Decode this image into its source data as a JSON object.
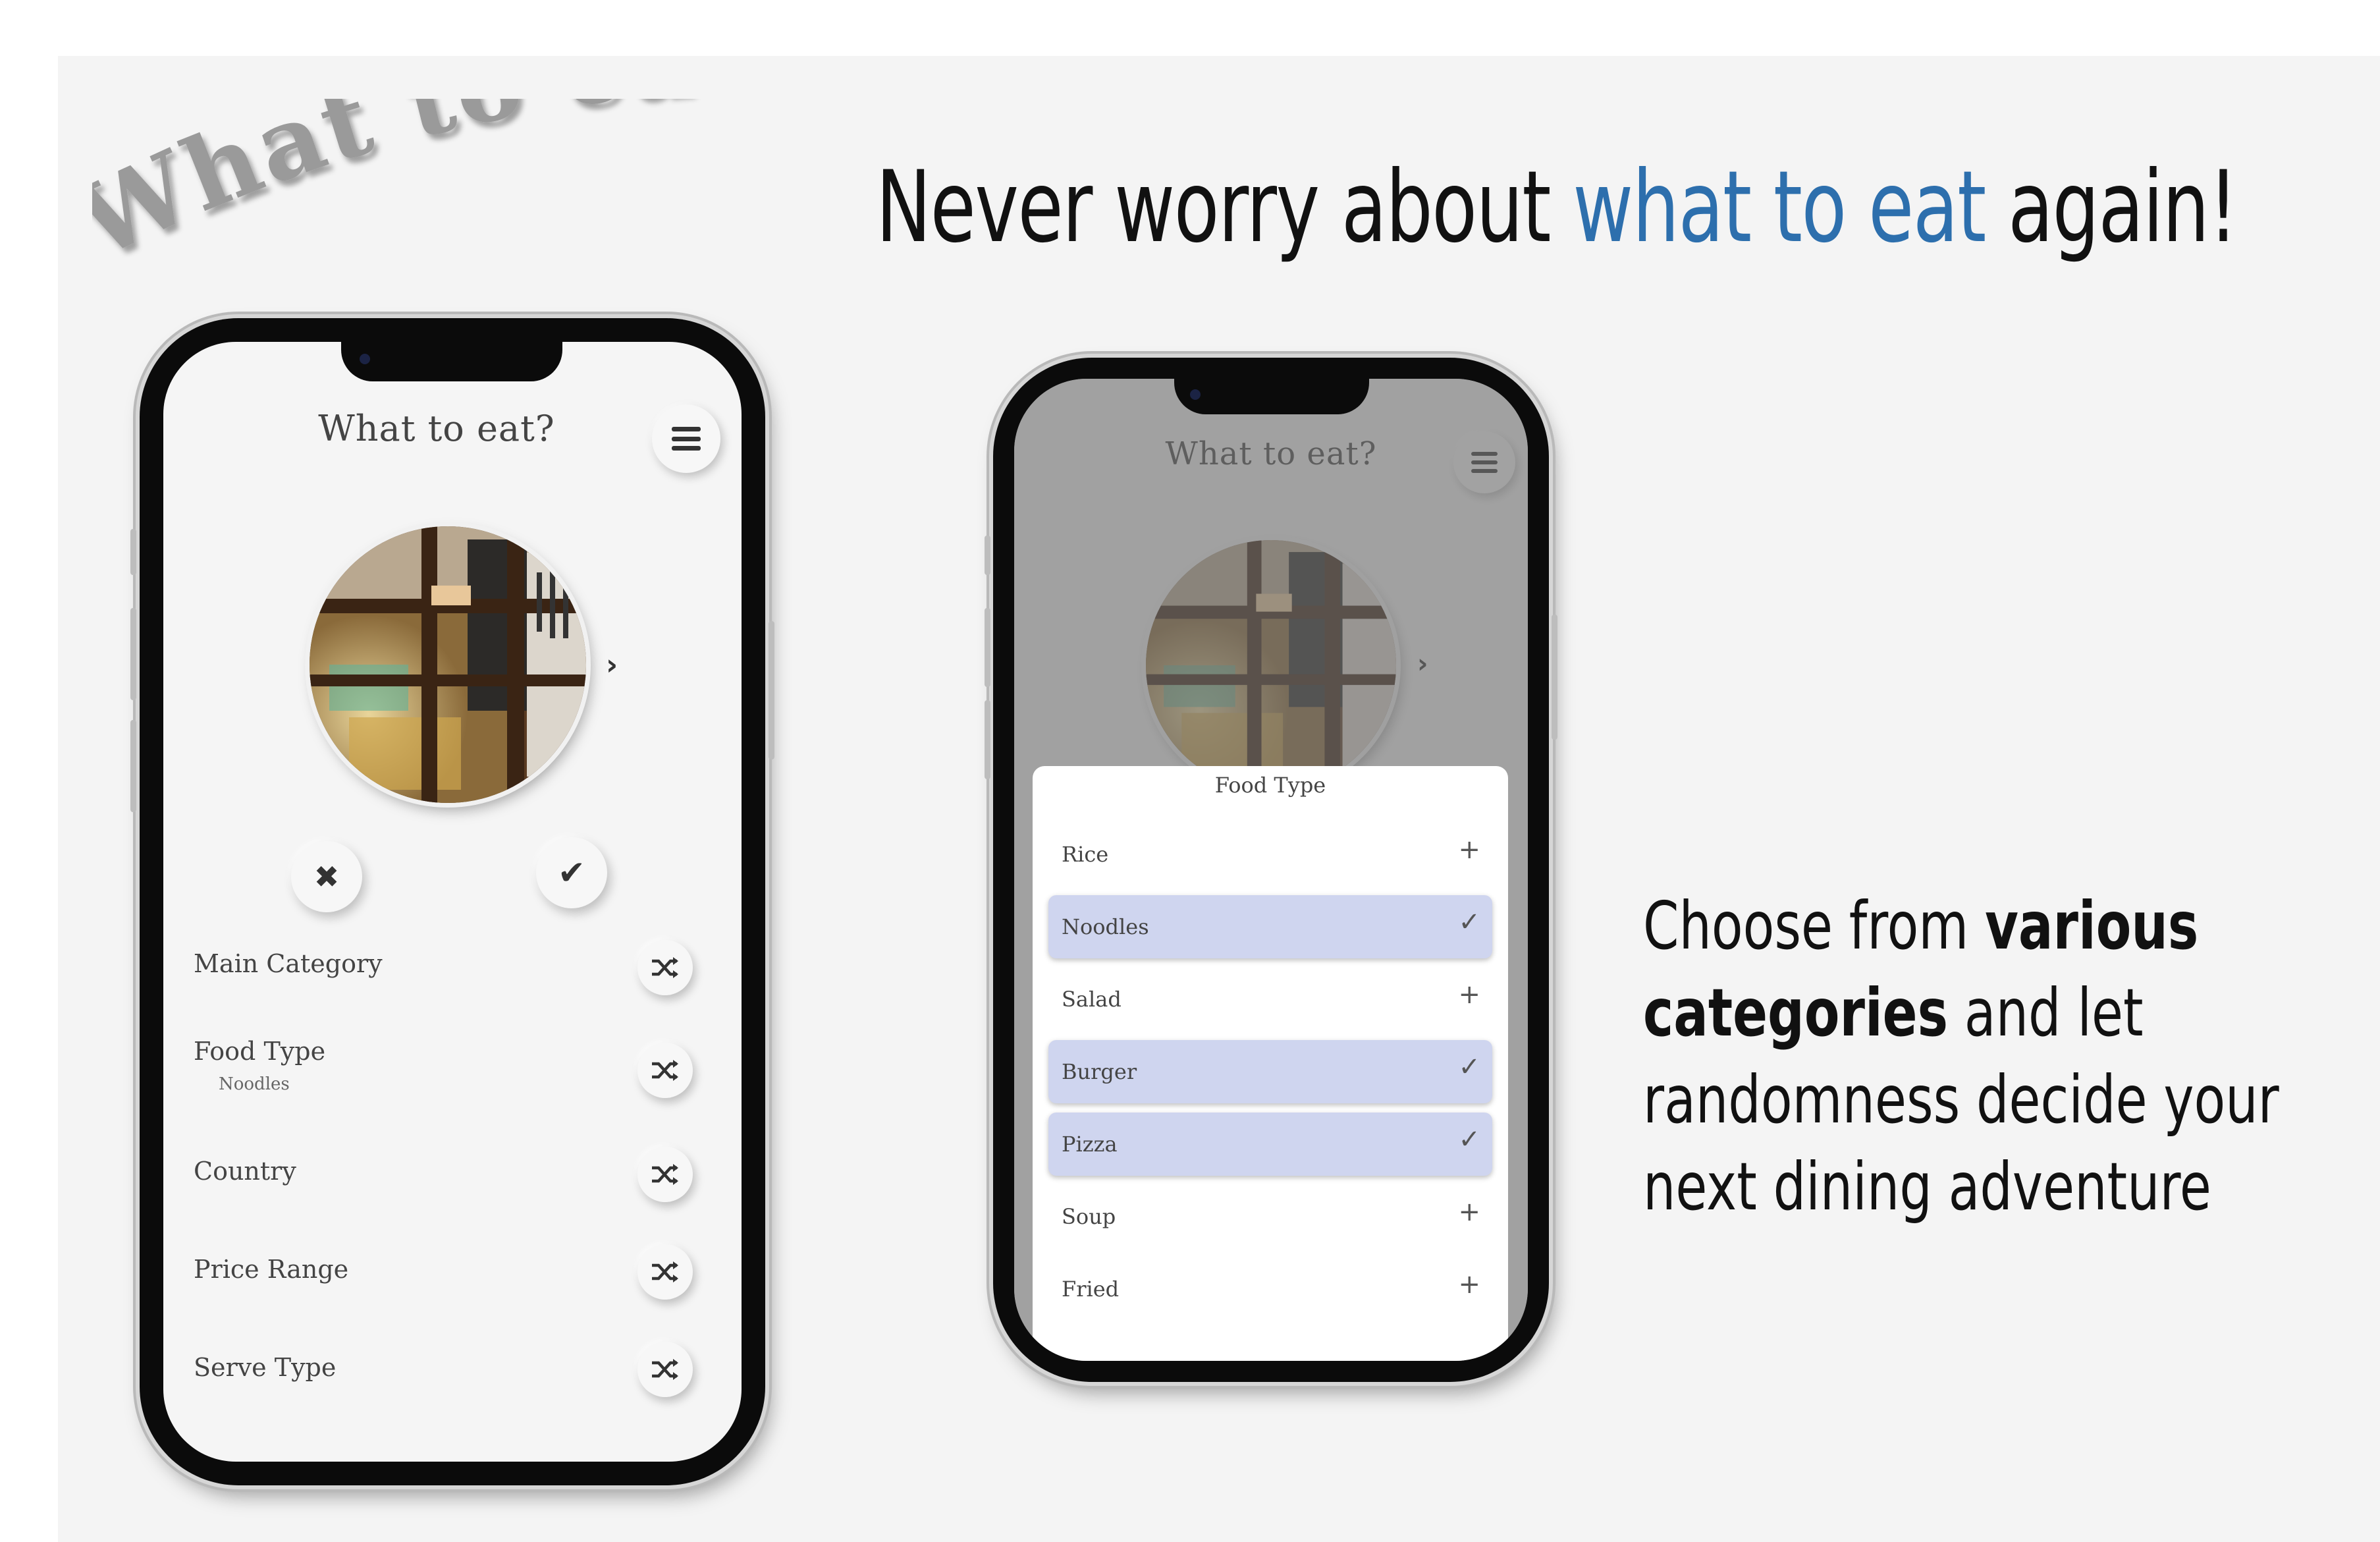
{
  "marketing": {
    "logo_text": "What to eat?",
    "headline_pre": "Never worry about ",
    "headline_highlight": "what to eat",
    "headline_post": " again!",
    "tagline_1": "Choose from ",
    "tagline_bold_1": "various",
    "tagline_bold_2": "categories",
    "tagline_2": " and let",
    "tagline_3": "randomness decide your",
    "tagline_4": "next dining adventure"
  },
  "colors": {
    "accent": "#2d6fad",
    "selected_bg": "#cfd5ef",
    "canvas_bg": "#f4f4f4"
  },
  "app": {
    "title": "What to eat?",
    "menu_icon": "hamburger-menu-icon",
    "next_icon": "chevron-right-icon",
    "reject_icon": "close-icon",
    "accept_icon": "check-icon",
    "shuffle_icon": "shuffle-icon",
    "categories": [
      {
        "label": "Main Category",
        "value": ""
      },
      {
        "label": "Food Type",
        "value": "Noodles"
      },
      {
        "label": "Country",
        "value": ""
      },
      {
        "label": "Price Range",
        "value": ""
      },
      {
        "label": "Serve Type",
        "value": ""
      }
    ]
  },
  "sheet": {
    "title": "Food Type",
    "options": [
      {
        "label": "Rice",
        "selected": false
      },
      {
        "label": "Noodles",
        "selected": true
      },
      {
        "label": "Salad",
        "selected": false
      },
      {
        "label": "Burger",
        "selected": true
      },
      {
        "label": "Pizza",
        "selected": true
      },
      {
        "label": "Soup",
        "selected": false
      },
      {
        "label": "Fried",
        "selected": false
      }
    ]
  }
}
